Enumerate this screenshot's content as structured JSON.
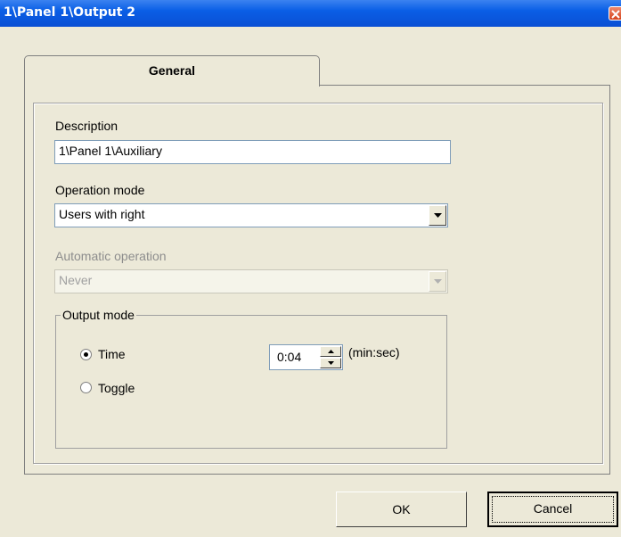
{
  "window": {
    "title": "1\\Panel 1\\Output 2"
  },
  "tabs": [
    {
      "label": "General"
    }
  ],
  "form": {
    "description": {
      "label": "Description",
      "value": "1\\Panel 1\\Auxiliary"
    },
    "operation_mode": {
      "label": "Operation mode",
      "value": "Users with right"
    },
    "automatic_operation": {
      "label": "Automatic operation",
      "value": "Never",
      "enabled": false
    },
    "output_mode": {
      "label": "Output mode",
      "options": [
        {
          "label": "Time",
          "selected": true
        },
        {
          "label": "Toggle",
          "selected": false
        }
      ],
      "time_value": "0:04",
      "time_unit": "(min:sec)"
    }
  },
  "buttons": {
    "ok": "OK",
    "cancel": "Cancel"
  },
  "icons": {
    "close": "close-icon",
    "dropdown": "chevron-down-icon",
    "spin_up": "spin-up-icon",
    "spin_down": "spin-down-icon"
  }
}
